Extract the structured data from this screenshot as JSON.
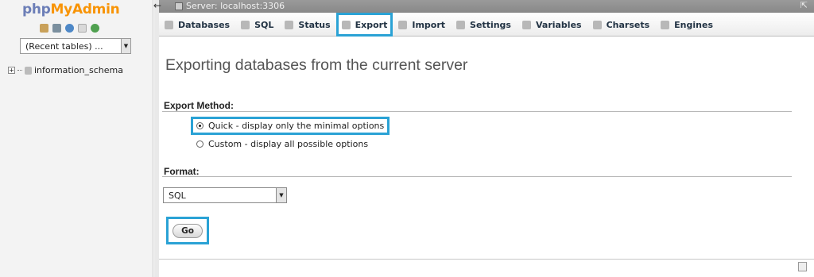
{
  "nav": {
    "logo_part1": "php",
    "logo_part2": "My",
    "logo_part3": "Admin",
    "quick_icons": [
      "home-icon",
      "exit-icon",
      "help-icon",
      "docs-icon",
      "reload-icon"
    ],
    "recent_tables": "(Recent tables) ...",
    "tree": [
      {
        "name": "information_schema",
        "expander": "+"
      }
    ]
  },
  "topbar": {
    "back": "←",
    "server": "Server: localhost:3306",
    "collapse": "⇱"
  },
  "tabs": [
    {
      "label": "Databases",
      "icon": "databases-icon"
    },
    {
      "label": "SQL",
      "icon": "sql-icon"
    },
    {
      "label": "Status",
      "icon": "status-icon"
    },
    {
      "label": "Export",
      "icon": "export-icon",
      "active": true
    },
    {
      "label": "Import",
      "icon": "import-icon"
    },
    {
      "label": "Settings",
      "icon": "settings-icon"
    },
    {
      "label": "Variables",
      "icon": "variables-icon"
    },
    {
      "label": "Charsets",
      "icon": "charsets-icon"
    },
    {
      "label": "Engines",
      "icon": "engines-icon"
    }
  ],
  "main": {
    "title": "Exporting databases from the current server",
    "export_method_label": "Export Method:",
    "options": [
      {
        "label": "Quick - display only the minimal options",
        "selected": true
      },
      {
        "label": "Custom - display all possible options",
        "selected": false
      }
    ],
    "format_label": "Format:",
    "format_value": "SQL",
    "go_label": "Go"
  },
  "colors": {
    "highlight": "#2aa2d5",
    "logo_php": "#6c7eb7",
    "logo_myadmin": "#f89406"
  }
}
